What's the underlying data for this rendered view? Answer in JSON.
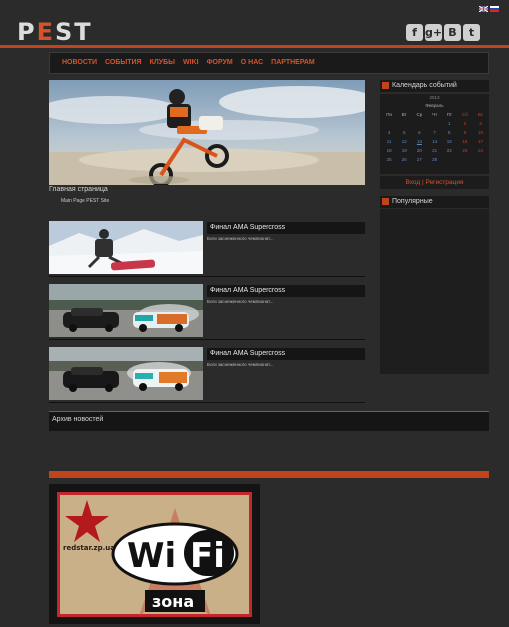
{
  "header": {
    "logo_p": "P",
    "logo_e": "E",
    "logo_st": "ST",
    "languages": [
      "en-flag-icon",
      "ru-flag-icon"
    ],
    "social": [
      {
        "icon": "facebook-icon",
        "glyph": "f"
      },
      {
        "icon": "google-plus-icon",
        "glyph": "g+"
      },
      {
        "icon": "vkontakte-icon",
        "glyph": "B"
      },
      {
        "icon": "twitter-icon",
        "glyph": "t"
      }
    ]
  },
  "nav": {
    "items": [
      "НОВОСТИ",
      "СОБЫТИЯ",
      "КЛУБЫ",
      "WIKI",
      "ФОРУМ",
      "О НАС",
      "ПАРТНЕРАМ"
    ]
  },
  "hero": {
    "title": "Главная страница",
    "subtitle": "Main Page PEST Site"
  },
  "news": [
    {
      "title": "Финал AMA Supercross",
      "excerpt": "Боги заснеженного чемпионат..."
    },
    {
      "title": "Финал AMA Supercross",
      "excerpt": "Боги заснеженного чемпионат..."
    },
    {
      "title": "Финал AMA Supercross",
      "excerpt": "Боги заснеженного чемпионат..."
    }
  ],
  "sidebar": {
    "calendar_title": "Календарь событий",
    "calendar_year": "2013",
    "calendar_month": "Февраль",
    "weekdays": [
      "Пн",
      "Вт",
      "Ср",
      "Чт",
      "Пт",
      "Сб",
      "Вс"
    ],
    "weeks": [
      [
        "",
        "",
        "",
        "",
        "1",
        "2",
        "3"
      ],
      [
        "4",
        "5",
        "6",
        "7",
        "8",
        "9",
        "10"
      ],
      [
        "11",
        "12",
        "13",
        "14",
        "15",
        "16",
        "17"
      ],
      [
        "18",
        "19",
        "20",
        "21",
        "22",
        "23",
        "24"
      ],
      [
        "25",
        "26",
        "27",
        "28",
        "",
        "",
        ""
      ]
    ],
    "login": "Вход",
    "separator": "|",
    "register": "Регистрация",
    "popular_title": "Популярные"
  },
  "archive": {
    "label": "Архив новостей"
  },
  "banner": {
    "site": "redstar.zp.ua",
    "wifi_left": "Wi",
    "wifi_right": "Fi",
    "zone": "зона"
  },
  "colors": {
    "accent": "#c2441c",
    "background": "#2a2b2a",
    "panel": "#1a1a1a"
  }
}
